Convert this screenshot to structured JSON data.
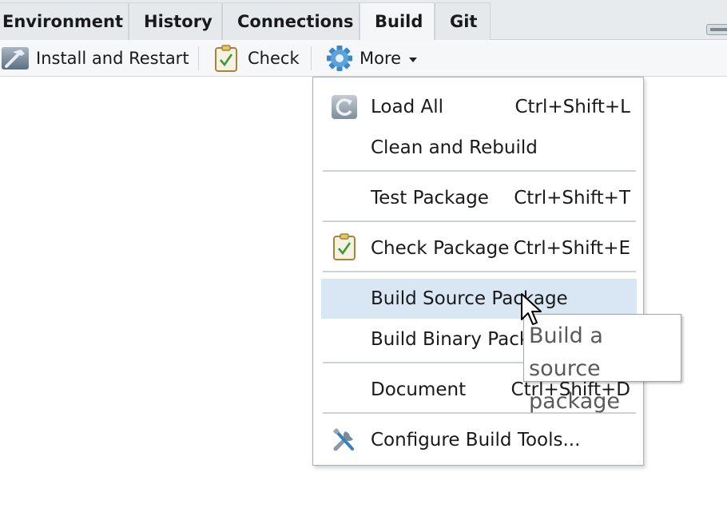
{
  "tabs": [
    {
      "label": "Environment",
      "active": false
    },
    {
      "label": "History",
      "active": false
    },
    {
      "label": "Connections",
      "active": false
    },
    {
      "label": "Build",
      "active": true
    },
    {
      "label": "Git",
      "active": false
    }
  ],
  "toolbar": {
    "install": {
      "label": "Install and Restart",
      "icon": "hammer-icon"
    },
    "check": {
      "label": "Check",
      "icon": "clipboard-check-icon"
    },
    "more": {
      "label": "More",
      "icon": "gear-icon"
    }
  },
  "menu": {
    "items": [
      {
        "label": "Load All",
        "shortcut": "Ctrl+Shift+L",
        "icon": "reload-icon"
      },
      {
        "label": "Clean and Rebuild",
        "shortcut": ""
      },
      {
        "label": "Test Package",
        "shortcut": "Ctrl+Shift+T"
      },
      {
        "label": "Check Package",
        "shortcut": "Ctrl+Shift+E",
        "icon": "clipboard-check-icon"
      },
      {
        "label": "Build Source Package",
        "shortcut": "",
        "highlighted": true
      },
      {
        "label": "Build Binary Package",
        "shortcut": ""
      },
      {
        "label": "Document",
        "shortcut": "Ctrl+Shift+D"
      },
      {
        "label": "Configure Build Tools...",
        "shortcut": "",
        "icon": "tools-icon"
      }
    ]
  },
  "tooltip": {
    "text": "Build a source package"
  },
  "colors": {
    "highlight": "#d9e7f5",
    "accent": "#3a7fc0"
  }
}
